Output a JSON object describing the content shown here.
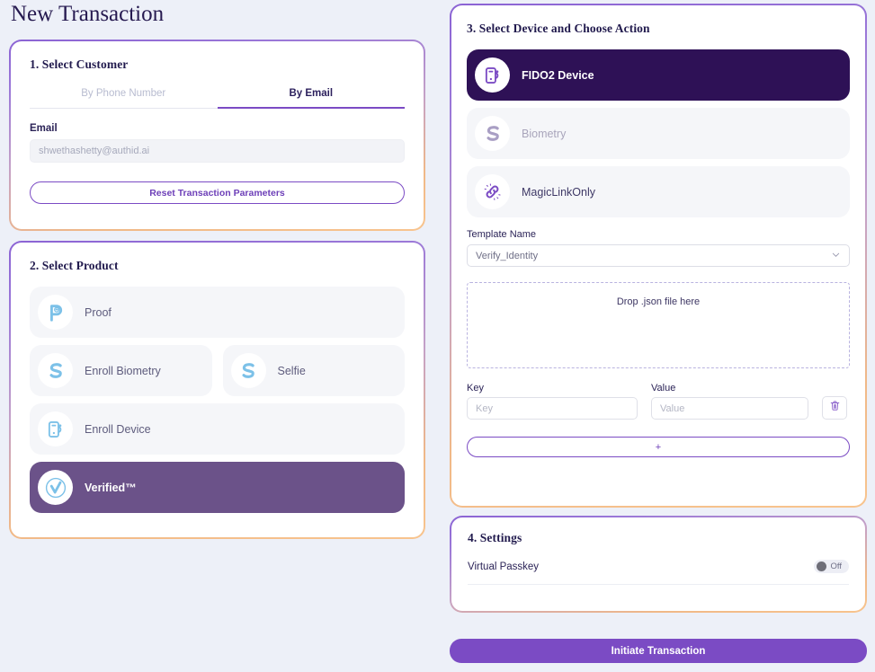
{
  "page": {
    "title": "New Transaction"
  },
  "customer": {
    "card_title": "1. Select Customer",
    "tabs": [
      {
        "label": "By Phone Number",
        "active": false
      },
      {
        "label": "By Email",
        "active": true
      }
    ],
    "email_label": "Email",
    "email_value": "shwethashetty@authid.ai",
    "reset_button": "Reset Transaction Parameters"
  },
  "product": {
    "card_title": "2. Select Product",
    "items": [
      {
        "label": "Proof",
        "icon": "proof-p-icon",
        "selected": false
      },
      {
        "label": "Enroll Biometry",
        "icon": "biometry-s-icon",
        "selected": false
      },
      {
        "label": "Selfie",
        "icon": "selfie-s-icon",
        "selected": false
      },
      {
        "label": "Enroll Device",
        "icon": "device-icon",
        "selected": false
      },
      {
        "label": "Verified™",
        "icon": "verified-check-icon",
        "selected": true
      }
    ]
  },
  "device": {
    "card_title": "3. Select Device and Choose Action",
    "items": [
      {
        "label": "FIDO2 Device",
        "icon": "fido2-device-icon",
        "selected": true
      },
      {
        "label": "Biometry",
        "icon": "biometry-s-icon",
        "selected": false
      },
      {
        "label": "MagicLinkOnly",
        "icon": "magic-link-icon",
        "selected": false
      }
    ],
    "template_label": "Template Name",
    "template_value": "Verify_Identity",
    "dropzone_text": "Drop .json file here",
    "key_label": "Key",
    "key_placeholder": "Key",
    "key_value": "",
    "value_label": "Value",
    "value_placeholder": "Value",
    "value_value": "",
    "delete_icon": "trash-icon",
    "add_button": "+"
  },
  "settings": {
    "card_title": "4. Settings",
    "rows": [
      {
        "label": "Virtual Passkey",
        "toggle_state": "Off",
        "on": false
      }
    ]
  },
  "footer": {
    "initiate_button": "Initiate Transaction"
  },
  "colors": {
    "accent_purple": "#7b4bc4",
    "accent_orange": "#f8c48e",
    "selected_product_bg": "#6b5289",
    "selected_device_bg": "#2e1156",
    "page_bg": "#edf0f8",
    "icon_blue": "#7cc1e8",
    "icon_purple": "#7b4bc4",
    "icon_grey_purple": "#a99fc4"
  }
}
